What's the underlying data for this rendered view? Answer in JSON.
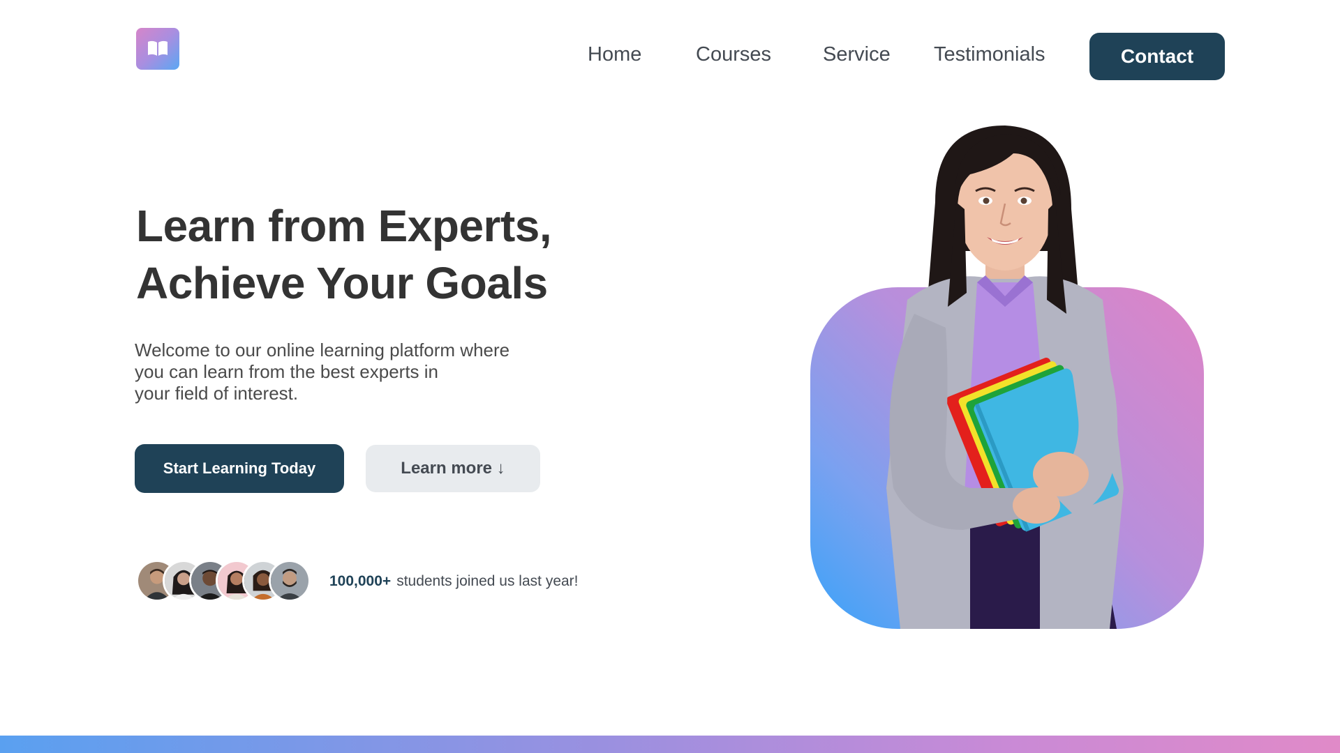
{
  "header": {
    "logo_icon": "open-book-icon",
    "nav": [
      "Home",
      "Courses",
      "Service",
      "Testimonials"
    ],
    "contact_label": "Contact"
  },
  "hero": {
    "title_lines": [
      "Learn from Experts,",
      "Achieve Your Goals"
    ],
    "description_lines": [
      "Welcome to our online learning platform where",
      "you can learn from the best experts in",
      "your field of interest."
    ],
    "primary_cta": "Start Learning Today",
    "secondary_cta": "Learn more ↓"
  },
  "social_proof": {
    "count": "100,000+",
    "text": "students joined us last year!"
  },
  "colors": {
    "primary": "#1f4257",
    "secondary_button_bg": "#e8ebee",
    "gradient_blue": "#3aa3f8",
    "gradient_pink": "#de84c6"
  }
}
